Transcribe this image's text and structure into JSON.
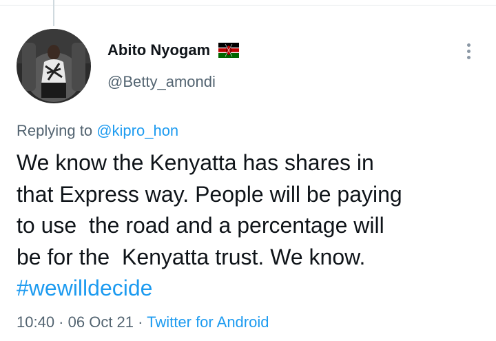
{
  "tweet": {
    "author": {
      "display_name": "Abito Nyogam",
      "flag_emoji_name": "kenya-flag-icon",
      "handle": "@Betty_amondi"
    },
    "replying_to": {
      "prefix": "Replying to",
      "mention": "@kipro_hon"
    },
    "body_lines": [
      "We know the Kenyatta has shares in",
      "that Express way. People will be paying",
      "to use  the road and a percentage will",
      "be for the  Kenyatta trust. We know."
    ],
    "hashtag": "#wewilldecide",
    "meta": {
      "time": "10:40",
      "separator": " · ",
      "date": "06 Oct 21",
      "source": "Twitter for Android"
    }
  },
  "colors": {
    "link": "#1d9bf0",
    "secondary_text": "#536471",
    "primary_text": "#0f1419"
  },
  "icons": [
    "more-options-icon",
    "kenya-flag-icon",
    "avatar"
  ]
}
